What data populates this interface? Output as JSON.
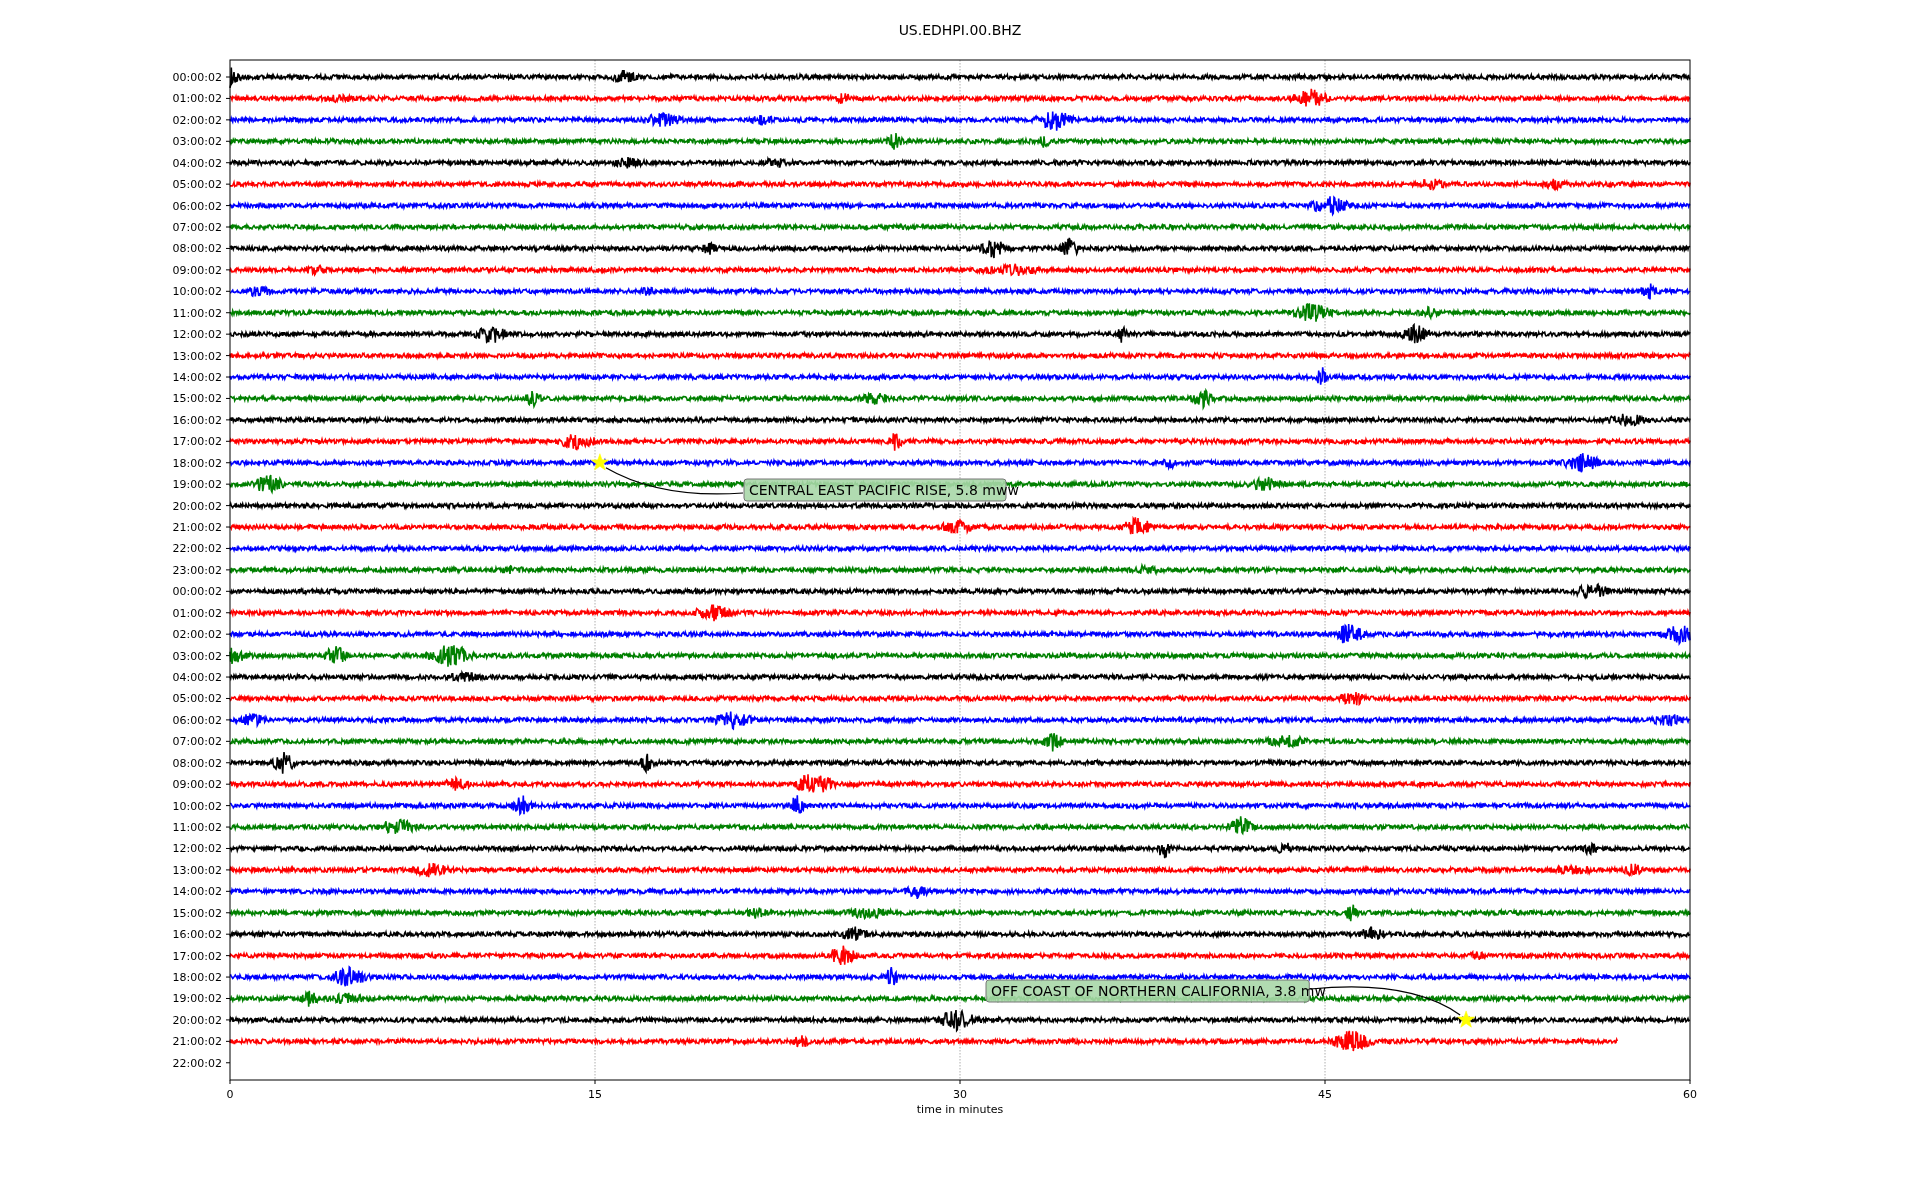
{
  "title": "US.EDHPI.00.BHZ",
  "xlabel": "time in minutes",
  "xticks": [
    "0",
    "15",
    "30",
    "45",
    "60"
  ],
  "rows": [
    {
      "label": "00:00:02",
      "color": "#000000",
      "kind": "full"
    },
    {
      "label": "01:00:02",
      "color": "#ff0000",
      "kind": "full"
    },
    {
      "label": "02:00:02",
      "color": "#0000ff",
      "kind": "full"
    },
    {
      "label": "03:00:02",
      "color": "#008000",
      "kind": "full"
    },
    {
      "label": "04:00:02",
      "color": "#000000",
      "kind": "full"
    },
    {
      "label": "05:00:02",
      "color": "#ff0000",
      "kind": "full"
    },
    {
      "label": "06:00:02",
      "color": "#0000ff",
      "kind": "full"
    },
    {
      "label": "07:00:02",
      "color": "#008000",
      "kind": "full"
    },
    {
      "label": "08:00:02",
      "color": "#000000",
      "kind": "full"
    },
    {
      "label": "09:00:02",
      "color": "#ff0000",
      "kind": "full"
    },
    {
      "label": "10:00:02",
      "color": "#0000ff",
      "kind": "full"
    },
    {
      "label": "11:00:02",
      "color": "#008000",
      "kind": "full"
    },
    {
      "label": "12:00:02",
      "color": "#000000",
      "kind": "full"
    },
    {
      "label": "13:00:02",
      "color": "#ff0000",
      "kind": "full"
    },
    {
      "label": "14:00:02",
      "color": "#0000ff",
      "kind": "full"
    },
    {
      "label": "15:00:02",
      "color": "#008000",
      "kind": "full"
    },
    {
      "label": "16:00:02",
      "color": "#000000",
      "kind": "full"
    },
    {
      "label": "17:00:02",
      "color": "#ff0000",
      "kind": "full"
    },
    {
      "label": "18:00:02",
      "color": "#0000ff",
      "kind": "full"
    },
    {
      "label": "19:00:02",
      "color": "#008000",
      "kind": "full"
    },
    {
      "label": "20:00:02",
      "color": "#000000",
      "kind": "full"
    },
    {
      "label": "21:00:02",
      "color": "#ff0000",
      "kind": "full"
    },
    {
      "label": "22:00:02",
      "color": "#0000ff",
      "kind": "full"
    },
    {
      "label": "23:00:02",
      "color": "#008000",
      "kind": "full"
    },
    {
      "label": "00:00:02",
      "color": "#000000",
      "kind": "full"
    },
    {
      "label": "01:00:02",
      "color": "#ff0000",
      "kind": "full"
    },
    {
      "label": "02:00:02",
      "color": "#0000ff",
      "kind": "full"
    },
    {
      "label": "03:00:02",
      "color": "#008000",
      "kind": "full"
    },
    {
      "label": "04:00:02",
      "color": "#000000",
      "kind": "full"
    },
    {
      "label": "05:00:02",
      "color": "#ff0000",
      "kind": "full"
    },
    {
      "label": "06:00:02",
      "color": "#0000ff",
      "kind": "full"
    },
    {
      "label": "07:00:02",
      "color": "#008000",
      "kind": "full"
    },
    {
      "label": "08:00:02",
      "color": "#000000",
      "kind": "full"
    },
    {
      "label": "09:00:02",
      "color": "#ff0000",
      "kind": "full"
    },
    {
      "label": "10:00:02",
      "color": "#0000ff",
      "kind": "full"
    },
    {
      "label": "11:00:02",
      "color": "#008000",
      "kind": "full"
    },
    {
      "label": "12:00:02",
      "color": "#000000",
      "kind": "full"
    },
    {
      "label": "13:00:02",
      "color": "#ff0000",
      "kind": "full"
    },
    {
      "label": "14:00:02",
      "color": "#0000ff",
      "kind": "full"
    },
    {
      "label": "15:00:02",
      "color": "#008000",
      "kind": "full"
    },
    {
      "label": "16:00:02",
      "color": "#000000",
      "kind": "full"
    },
    {
      "label": "17:00:02",
      "color": "#ff0000",
      "kind": "full"
    },
    {
      "label": "18:00:02",
      "color": "#0000ff",
      "kind": "full"
    },
    {
      "label": "19:00:02",
      "color": "#008000",
      "kind": "full"
    },
    {
      "label": "20:00:02",
      "color": "#000000",
      "kind": "full"
    },
    {
      "label": "21:00:02",
      "color": "#ff0000",
      "kind": "partial"
    },
    {
      "label": "22:00:02",
      "kind": "none"
    }
  ],
  "events": [
    {
      "text": "CENTRAL EAST PACIFIC RISE, 5.8 mww"
    },
    {
      "text": "OFF COAST OF NORTHERN CALIFORNIA, 3.8 mw"
    }
  ]
}
